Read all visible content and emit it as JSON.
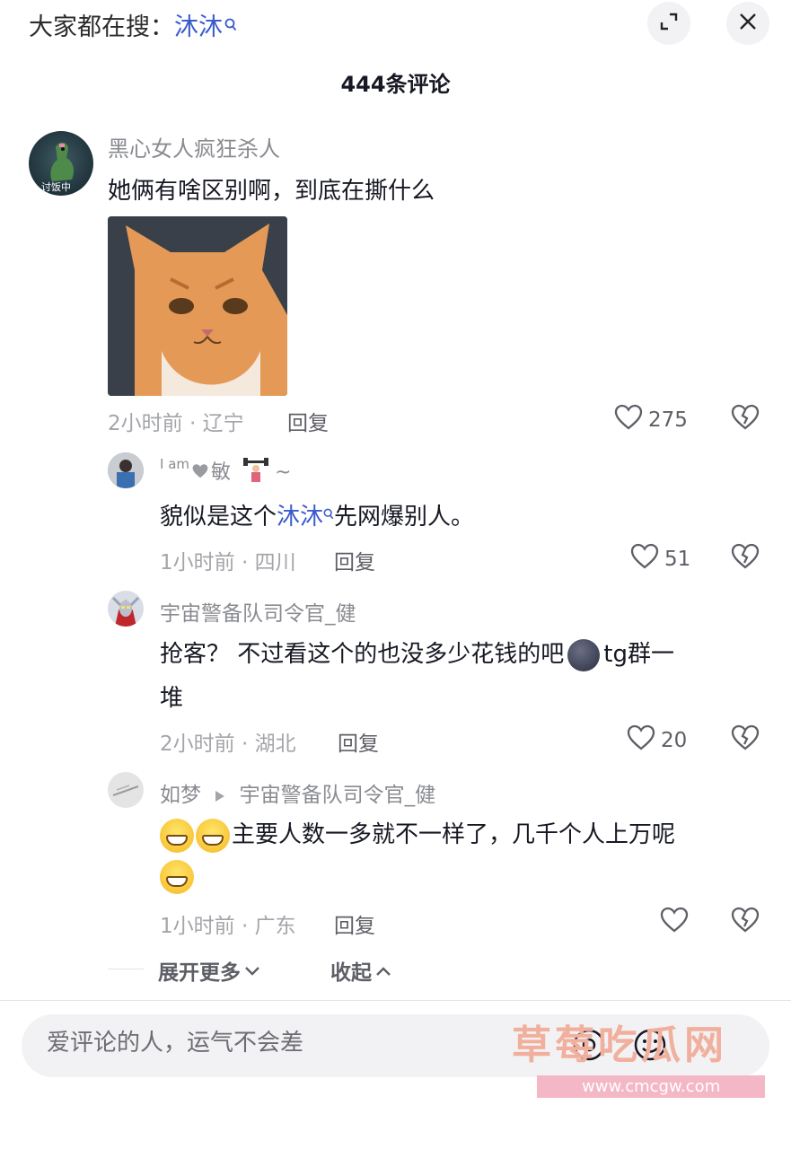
{
  "header": {
    "search_prefix": "大家都在搜：",
    "search_keyword": "沐沐",
    "comment_count_title": "444条评论"
  },
  "comments": [
    {
      "username": "黑心女人疯狂杀人",
      "avatar_label": "讨饭中",
      "text": "她俩有啥区别啊，到底在撕什么",
      "time_location": "2小时前 · 辽宁",
      "reply_label": "回复",
      "likes": "275"
    },
    {
      "username": "I am",
      "username_suffix": "敏",
      "username_tail": "~",
      "text_before": "貌似是这个",
      "text_keyword": "沐沐",
      "text_after": "先网爆别人。",
      "time_location": "1小时前 · 四川",
      "reply_label": "回复",
      "likes": "51"
    },
    {
      "username": "宇宙警备队司令官_健",
      "text_line1_a": "抢客？ 不过看这个的也没多少花钱的吧",
      "text_line1_b": "tg群一",
      "text_line2": "堆",
      "time_location": "2小时前 · 湖北",
      "reply_label": "回复",
      "likes": "20"
    },
    {
      "username": "如梦",
      "reply_to": "宇宙警备队司令官_健",
      "text": "主要人数一多就不一样了，几千个人上万呢",
      "time_location": "1小时前 · 广东",
      "reply_label": "回复",
      "likes": ""
    }
  ],
  "expand_more_label": "展开更多",
  "collapse_label": "收起",
  "input": {
    "placeholder": "爱评论的人，运气不会差"
  },
  "watermark": {
    "title": "草莓吃瓜网",
    "url": "www.cmcgw.com"
  },
  "colors": {
    "keyword_blue": "#3a5bcc",
    "meta_gray": "#a4a5aa",
    "text_dark": "#161823"
  }
}
